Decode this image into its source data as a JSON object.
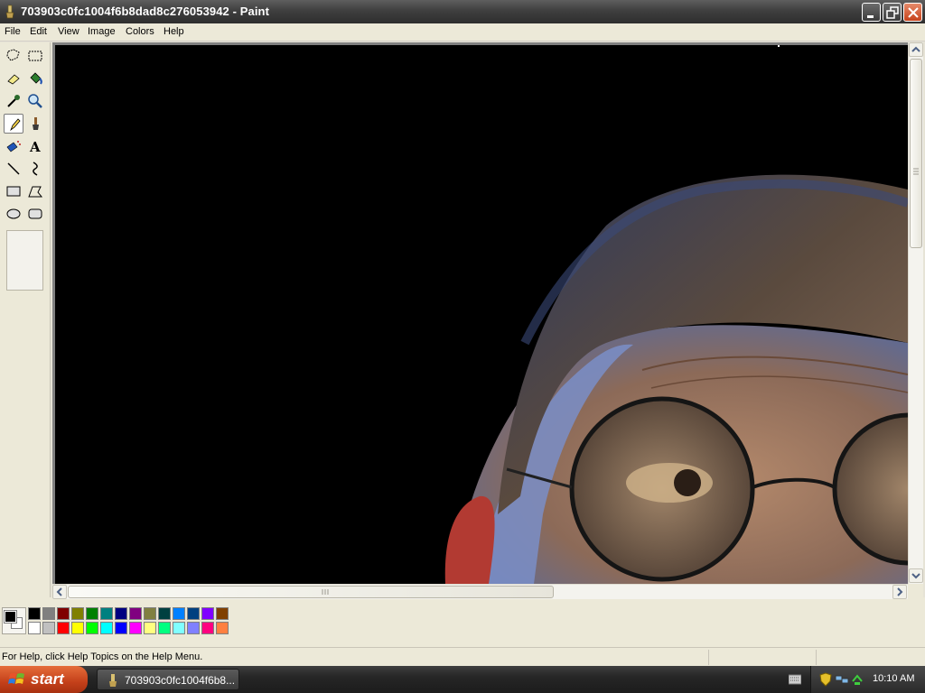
{
  "window": {
    "title": "703903c0fc1004f6b8dad8c276053942 - Paint",
    "app": "Paint"
  },
  "menu": [
    "File",
    "Edit",
    "View",
    "Image",
    "Colors",
    "Help"
  ],
  "tools": [
    {
      "name": "free-form-select-tool-icon"
    },
    {
      "name": "select-tool-icon"
    },
    {
      "name": "eraser-tool-icon"
    },
    {
      "name": "fill-with-color-tool-icon"
    },
    {
      "name": "pick-color-tool-icon"
    },
    {
      "name": "magnifier-tool-icon"
    },
    {
      "name": "pencil-tool-icon",
      "selected": true
    },
    {
      "name": "brush-tool-icon"
    },
    {
      "name": "airbrush-tool-icon"
    },
    {
      "name": "text-tool-icon",
      "glyph": "A"
    },
    {
      "name": "line-tool-icon"
    },
    {
      "name": "curve-tool-icon"
    },
    {
      "name": "rectangle-tool-icon"
    },
    {
      "name": "polygon-tool-icon"
    },
    {
      "name": "ellipse-tool-icon"
    },
    {
      "name": "rounded-rectangle-tool-icon"
    }
  ],
  "palette": {
    "foreground": "#000000",
    "background": "#ffffff",
    "row1": [
      "#000000",
      "#808080",
      "#800000",
      "#808000",
      "#008000",
      "#008080",
      "#000080",
      "#800080",
      "#808040",
      "#004040",
      "#0080ff",
      "#004080",
      "#8000ff",
      "#804000"
    ],
    "row2": [
      "#ffffff",
      "#c0c0c0",
      "#ff0000",
      "#ffff00",
      "#00ff00",
      "#00ffff",
      "#0000ff",
      "#ff00ff",
      "#ffff80",
      "#00ff80",
      "#80ffff",
      "#8080ff",
      "#ff0080",
      "#ff8040"
    ]
  },
  "status": {
    "help_text": "For Help, click Help Topics on the Help Menu."
  },
  "taskbar": {
    "start_label": "start",
    "task_label": "703903c0fc1004f6b8...",
    "clock": "10:10 AM"
  }
}
